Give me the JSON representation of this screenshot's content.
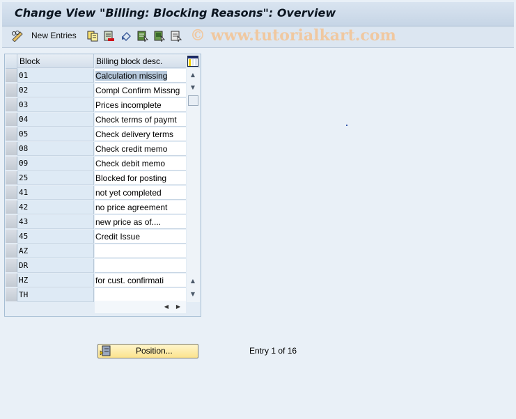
{
  "window": {
    "title": "Change View \"Billing: Blocking Reasons\": Overview"
  },
  "toolbar": {
    "new_entries_label": "New Entries",
    "icons": [
      "edit-glasses-icon",
      "copy-icon",
      "delete-icon",
      "undo-icon",
      "select-all-icon",
      "select-block-icon",
      "deselect-all-icon"
    ],
    "watermark": "© www.tutorialkart.com"
  },
  "table": {
    "columns": [
      "Block",
      "Billing block desc."
    ],
    "rows": [
      {
        "block": "01",
        "desc": "Calculation missing"
      },
      {
        "block": "02",
        "desc": "Compl Confirm Missng"
      },
      {
        "block": "03",
        "desc": "Prices incomplete"
      },
      {
        "block": "04",
        "desc": "Check terms of paymt"
      },
      {
        "block": "05",
        "desc": "Check delivery terms"
      },
      {
        "block": "08",
        "desc": "Check credit memo"
      },
      {
        "block": "09",
        "desc": "Check debit memo"
      },
      {
        "block": "25",
        "desc": "Blocked for posting"
      },
      {
        "block": "41",
        "desc": "not yet completed"
      },
      {
        "block": "42",
        "desc": "no price agreement"
      },
      {
        "block": "43",
        "desc": "new price as of...."
      },
      {
        "block": "45",
        "desc": "Credit Issue"
      },
      {
        "block": "AZ",
        "desc": ""
      },
      {
        "block": "DR",
        "desc": ""
      },
      {
        "block": "HZ",
        "desc": "for cust. confirmati"
      },
      {
        "block": "TH",
        "desc": ""
      }
    ],
    "highlighted_row": 0
  },
  "footer": {
    "position_button": "Position...",
    "entry_status": "Entry 1 of 16"
  }
}
